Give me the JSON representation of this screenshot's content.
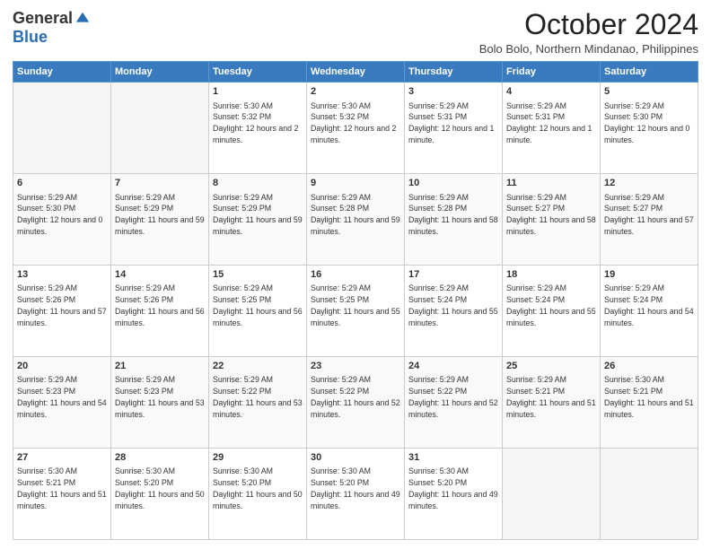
{
  "logo": {
    "general": "General",
    "blue": "Blue"
  },
  "header": {
    "month": "October 2024",
    "subtitle": "Bolo Bolo, Northern Mindanao, Philippines"
  },
  "weekdays": [
    "Sunday",
    "Monday",
    "Tuesday",
    "Wednesday",
    "Thursday",
    "Friday",
    "Saturday"
  ],
  "weeks": [
    [
      {
        "day": "",
        "empty": true
      },
      {
        "day": "",
        "empty": true
      },
      {
        "day": "1",
        "sunrise": "Sunrise: 5:30 AM",
        "sunset": "Sunset: 5:32 PM",
        "daylight": "Daylight: 12 hours and 2 minutes."
      },
      {
        "day": "2",
        "sunrise": "Sunrise: 5:30 AM",
        "sunset": "Sunset: 5:32 PM",
        "daylight": "Daylight: 12 hours and 2 minutes."
      },
      {
        "day": "3",
        "sunrise": "Sunrise: 5:29 AM",
        "sunset": "Sunset: 5:31 PM",
        "daylight": "Daylight: 12 hours and 1 minute."
      },
      {
        "day": "4",
        "sunrise": "Sunrise: 5:29 AM",
        "sunset": "Sunset: 5:31 PM",
        "daylight": "Daylight: 12 hours and 1 minute."
      },
      {
        "day": "5",
        "sunrise": "Sunrise: 5:29 AM",
        "sunset": "Sunset: 5:30 PM",
        "daylight": "Daylight: 12 hours and 0 minutes."
      }
    ],
    [
      {
        "day": "6",
        "sunrise": "Sunrise: 5:29 AM",
        "sunset": "Sunset: 5:30 PM",
        "daylight": "Daylight: 12 hours and 0 minutes."
      },
      {
        "day": "7",
        "sunrise": "Sunrise: 5:29 AM",
        "sunset": "Sunset: 5:29 PM",
        "daylight": "Daylight: 11 hours and 59 minutes."
      },
      {
        "day": "8",
        "sunrise": "Sunrise: 5:29 AM",
        "sunset": "Sunset: 5:29 PM",
        "daylight": "Daylight: 11 hours and 59 minutes."
      },
      {
        "day": "9",
        "sunrise": "Sunrise: 5:29 AM",
        "sunset": "Sunset: 5:28 PM",
        "daylight": "Daylight: 11 hours and 59 minutes."
      },
      {
        "day": "10",
        "sunrise": "Sunrise: 5:29 AM",
        "sunset": "Sunset: 5:28 PM",
        "daylight": "Daylight: 11 hours and 58 minutes."
      },
      {
        "day": "11",
        "sunrise": "Sunrise: 5:29 AM",
        "sunset": "Sunset: 5:27 PM",
        "daylight": "Daylight: 11 hours and 58 minutes."
      },
      {
        "day": "12",
        "sunrise": "Sunrise: 5:29 AM",
        "sunset": "Sunset: 5:27 PM",
        "daylight": "Daylight: 11 hours and 57 minutes."
      }
    ],
    [
      {
        "day": "13",
        "sunrise": "Sunrise: 5:29 AM",
        "sunset": "Sunset: 5:26 PM",
        "daylight": "Daylight: 11 hours and 57 minutes."
      },
      {
        "day": "14",
        "sunrise": "Sunrise: 5:29 AM",
        "sunset": "Sunset: 5:26 PM",
        "daylight": "Daylight: 11 hours and 56 minutes."
      },
      {
        "day": "15",
        "sunrise": "Sunrise: 5:29 AM",
        "sunset": "Sunset: 5:25 PM",
        "daylight": "Daylight: 11 hours and 56 minutes."
      },
      {
        "day": "16",
        "sunrise": "Sunrise: 5:29 AM",
        "sunset": "Sunset: 5:25 PM",
        "daylight": "Daylight: 11 hours and 55 minutes."
      },
      {
        "day": "17",
        "sunrise": "Sunrise: 5:29 AM",
        "sunset": "Sunset: 5:24 PM",
        "daylight": "Daylight: 11 hours and 55 minutes."
      },
      {
        "day": "18",
        "sunrise": "Sunrise: 5:29 AM",
        "sunset": "Sunset: 5:24 PM",
        "daylight": "Daylight: 11 hours and 55 minutes."
      },
      {
        "day": "19",
        "sunrise": "Sunrise: 5:29 AM",
        "sunset": "Sunset: 5:24 PM",
        "daylight": "Daylight: 11 hours and 54 minutes."
      }
    ],
    [
      {
        "day": "20",
        "sunrise": "Sunrise: 5:29 AM",
        "sunset": "Sunset: 5:23 PM",
        "daylight": "Daylight: 11 hours and 54 minutes."
      },
      {
        "day": "21",
        "sunrise": "Sunrise: 5:29 AM",
        "sunset": "Sunset: 5:23 PM",
        "daylight": "Daylight: 11 hours and 53 minutes."
      },
      {
        "day": "22",
        "sunrise": "Sunrise: 5:29 AM",
        "sunset": "Sunset: 5:22 PM",
        "daylight": "Daylight: 11 hours and 53 minutes."
      },
      {
        "day": "23",
        "sunrise": "Sunrise: 5:29 AM",
        "sunset": "Sunset: 5:22 PM",
        "daylight": "Daylight: 11 hours and 52 minutes."
      },
      {
        "day": "24",
        "sunrise": "Sunrise: 5:29 AM",
        "sunset": "Sunset: 5:22 PM",
        "daylight": "Daylight: 11 hours and 52 minutes."
      },
      {
        "day": "25",
        "sunrise": "Sunrise: 5:29 AM",
        "sunset": "Sunset: 5:21 PM",
        "daylight": "Daylight: 11 hours and 51 minutes."
      },
      {
        "day": "26",
        "sunrise": "Sunrise: 5:30 AM",
        "sunset": "Sunset: 5:21 PM",
        "daylight": "Daylight: 11 hours and 51 minutes."
      }
    ],
    [
      {
        "day": "27",
        "sunrise": "Sunrise: 5:30 AM",
        "sunset": "Sunset: 5:21 PM",
        "daylight": "Daylight: 11 hours and 51 minutes."
      },
      {
        "day": "28",
        "sunrise": "Sunrise: 5:30 AM",
        "sunset": "Sunset: 5:20 PM",
        "daylight": "Daylight: 11 hours and 50 minutes."
      },
      {
        "day": "29",
        "sunrise": "Sunrise: 5:30 AM",
        "sunset": "Sunset: 5:20 PM",
        "daylight": "Daylight: 11 hours and 50 minutes."
      },
      {
        "day": "30",
        "sunrise": "Sunrise: 5:30 AM",
        "sunset": "Sunset: 5:20 PM",
        "daylight": "Daylight: 11 hours and 49 minutes."
      },
      {
        "day": "31",
        "sunrise": "Sunrise: 5:30 AM",
        "sunset": "Sunset: 5:20 PM",
        "daylight": "Daylight: 11 hours and 49 minutes."
      },
      {
        "day": "",
        "empty": true
      },
      {
        "day": "",
        "empty": true
      }
    ]
  ]
}
